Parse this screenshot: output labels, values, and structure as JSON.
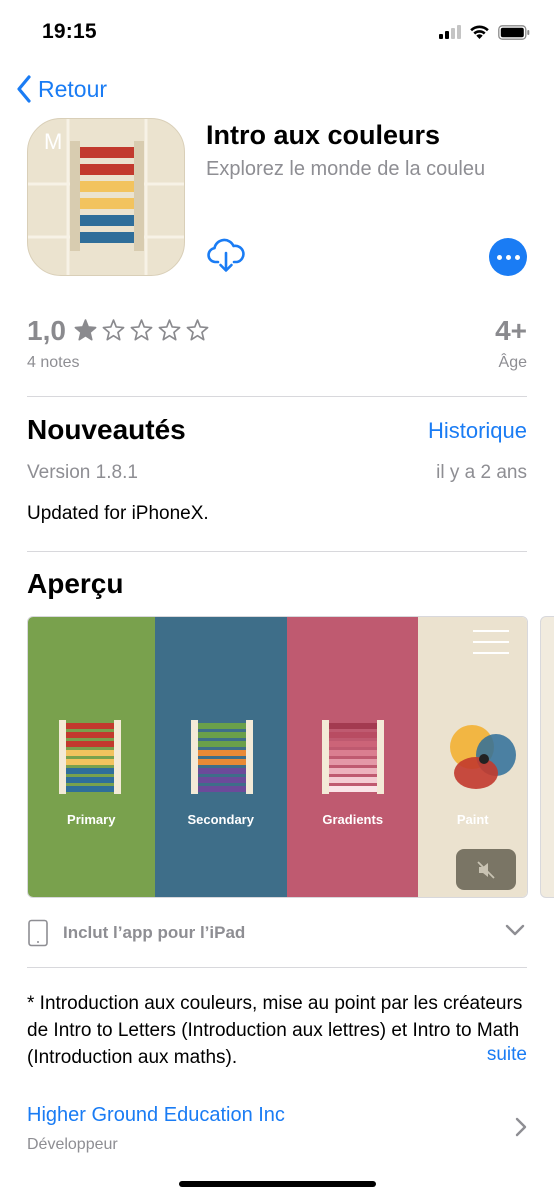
{
  "status_bar": {
    "time": "19:15"
  },
  "nav": {
    "back_label": "Retour"
  },
  "app": {
    "icon_letter": "M",
    "title": "Intro aux couleurs",
    "subtitle": "Explorez le monde de la couleu"
  },
  "ratings": {
    "value": "1,0",
    "stars_filled": 1,
    "stars_total": 5,
    "count_label": "4 notes",
    "age_value": "4+",
    "age_label": "Âge"
  },
  "whats_new": {
    "title": "Nouveautés",
    "history_link": "Historique",
    "version": "Version 1.8.1",
    "date": "il y a 2 ans",
    "notes": "Updated for iPhoneX."
  },
  "preview": {
    "title": "Aperçu",
    "panels": [
      {
        "label": "Primary",
        "bg": "#79a14d"
      },
      {
        "label": "Secondary",
        "bg": "#3e6e89"
      },
      {
        "label": "Gradients",
        "bg": "#bf5a70"
      },
      {
        "label": "Paint",
        "bg": "#ebe2cf"
      }
    ],
    "ipad_label": "Inclut l’app pour l’iPad"
  },
  "description": {
    "text": "* Introduction aux couleurs, mise au point par les créateurs de Intro to Letters (Introduction aux lettres) et Intro to Math (Introduction aux maths).",
    "more_link": "suite"
  },
  "developer": {
    "name": "Higher Ground Education Inc",
    "label": "Développeur"
  },
  "colors": {
    "accent": "#1a7cf4",
    "secondary_text": "#8e8e93"
  },
  "icons": [
    "signal-icon",
    "wifi-icon",
    "battery-icon",
    "back-chevron-icon",
    "download-cloud-icon",
    "more-dots-icon",
    "star-icon",
    "tablet-icon",
    "chevron-down-icon",
    "chevron-right-icon",
    "menu-icon",
    "mute-icon"
  ]
}
